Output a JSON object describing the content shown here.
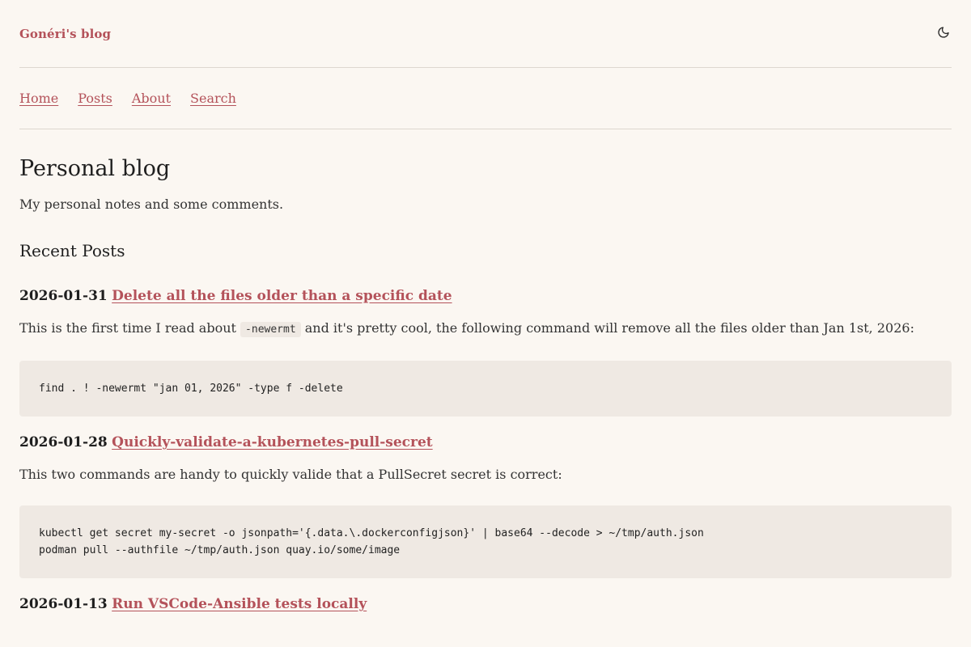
{
  "header": {
    "site_title": "Gonéri's blog",
    "theme_toggle_icon": "moon-icon"
  },
  "nav": {
    "items": [
      {
        "label": "Home"
      },
      {
        "label": "Posts"
      },
      {
        "label": "About"
      },
      {
        "label": "Search"
      }
    ]
  },
  "main": {
    "title": "Personal blog",
    "description": "My personal notes and some comments.",
    "recent_title": "Recent Posts"
  },
  "posts": [
    {
      "date": "2026-01-31",
      "title": "Delete all the files older than a specific date",
      "summary_before": "This is the first time I read about ",
      "summary_code": "-newermt",
      "summary_after": " and it's pretty cool, the following command will remove all the files older than Jan 1st, 2026:",
      "code": "find . ! -newermt \"jan 01, 2026\" -type f -delete"
    },
    {
      "date": "2026-01-28",
      "title": "Quickly-validate-a-kubernetes-pull-secret",
      "summary": "This two commands are handy to quickly valide that a PullSecret secret is correct:",
      "code_line1": "kubectl get secret my-secret -o jsonpath='{.data.\\.dockerconfigjson}' | base64 --decode > ~/tmp/auth.json",
      "code_line2": "podman pull --authfile ~/tmp/auth.json quay.io/some/image"
    },
    {
      "date": "2026-01-13",
      "title": "Run VSCode-Ansible tests locally"
    }
  ],
  "colors": {
    "background": "#fbf7f2",
    "accent": "#b4525a",
    "code_background": "#efe9e3",
    "divider": "#ddd7cf"
  }
}
